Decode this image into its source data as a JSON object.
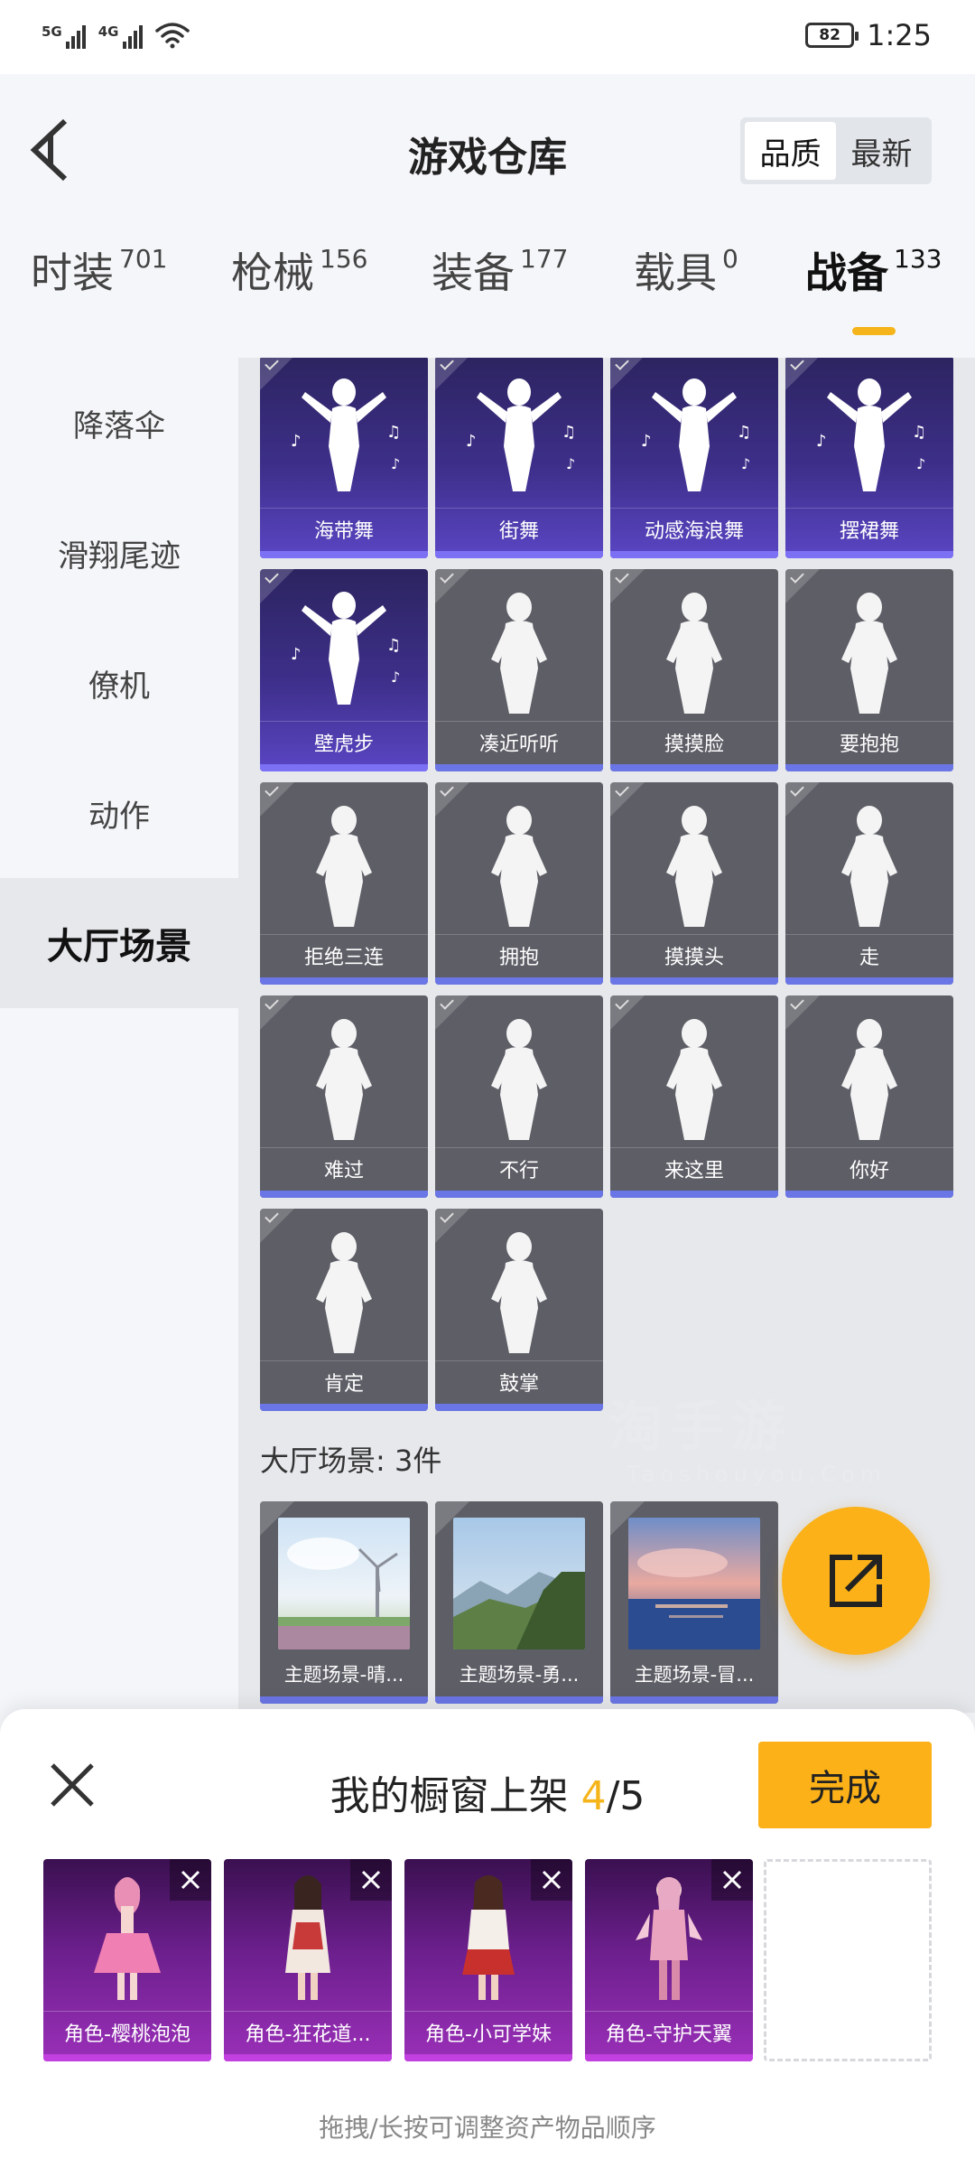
{
  "status_bar": {
    "sim1_label": "5G",
    "sim2_label": "4G",
    "battery": "82",
    "time": "1:25"
  },
  "header": {
    "title": "游戏仓库",
    "sort_options": [
      {
        "label": "品质",
        "active": true
      },
      {
        "label": "最新",
        "active": false
      }
    ]
  },
  "tabs": [
    {
      "label": "时装",
      "count": "701"
    },
    {
      "label": "枪械",
      "count": "156"
    },
    {
      "label": "装备",
      "count": "177"
    },
    {
      "label": "载具",
      "count": "0"
    },
    {
      "label": "战备",
      "count": "133",
      "active": true
    }
  ],
  "sidebar": {
    "items": [
      {
        "label": "降落伞"
      },
      {
        "label": "滑翔尾迹"
      },
      {
        "label": "僚机"
      },
      {
        "label": "动作"
      },
      {
        "label": "大厅场景",
        "active": true
      }
    ]
  },
  "actions": {
    "items": [
      {
        "label": "海带舞",
        "style": "purple",
        "icon": "dance-figure-icon"
      },
      {
        "label": "街舞",
        "style": "purple",
        "icon": "dance-figure-icon"
      },
      {
        "label": "动感海浪舞",
        "style": "purple",
        "icon": "dance-figure-icon"
      },
      {
        "label": "摆裙舞",
        "style": "purple",
        "icon": "dance-figure-icon"
      },
      {
        "label": "壁虎步",
        "style": "purple",
        "icon": "dance-figure-icon"
      },
      {
        "label": "凑近听听",
        "style": "gray",
        "icon": "listen-figure-icon"
      },
      {
        "label": "摸摸脸",
        "style": "gray",
        "icon": "touch-face-figure-icon"
      },
      {
        "label": "要抱抱",
        "style": "gray",
        "icon": "open-arms-figure-icon"
      },
      {
        "label": "拒绝三连",
        "style": "gray",
        "icon": "crossed-arms-figure-icon"
      },
      {
        "label": "拥抱",
        "style": "gray",
        "icon": "hug-figure-icon"
      },
      {
        "label": "摸摸头",
        "style": "gray",
        "icon": "pat-head-figure-icon"
      },
      {
        "label": "走",
        "style": "gray",
        "icon": "pointing-hand-icon"
      },
      {
        "label": "难过",
        "style": "gray",
        "icon": "sad-figure-icon"
      },
      {
        "label": "不行",
        "style": "gray",
        "icon": "head-shake-figure-icon"
      },
      {
        "label": "来这里",
        "style": "gray",
        "icon": "beckon-figure-icon"
      },
      {
        "label": "你好",
        "style": "gray",
        "icon": "wave-figure-icon"
      },
      {
        "label": "肯定",
        "style": "gray",
        "icon": "nod-figure-icon"
      },
      {
        "label": "鼓掌",
        "style": "gray",
        "icon": "clapping-hands-icon"
      }
    ]
  },
  "scenes": {
    "title": "大厅场景: 3件",
    "items": [
      {
        "label": "主题场景-晴...",
        "icon": "scene-windmill-thumbnail"
      },
      {
        "label": "主题场景-勇...",
        "icon": "scene-mountain-thumbnail"
      },
      {
        "label": "主题场景-冒...",
        "icon": "scene-sunset-sea-thumbnail"
      }
    ]
  },
  "showcase": {
    "title_prefix": "我的橱窗上架 ",
    "current": "4",
    "total": "/5",
    "done_label": "完成",
    "slots": [
      {
        "label": "角色-樱桃泡泡",
        "icon": "character-pink-dress-icon"
      },
      {
        "label": "角色-狂花道...",
        "icon": "character-kimono-icon"
      },
      {
        "label": "角色-小可学妹",
        "icon": "character-shrine-maiden-icon"
      },
      {
        "label": "角色-守护天翼",
        "icon": "character-angel-icon"
      }
    ],
    "hint": "拖拽/长按可调整资产物品顺序"
  },
  "watermark": {
    "text": "淘手游",
    "url": "Taoshouyou.Com"
  },
  "colors": {
    "accent": "#fbb117",
    "purple_card": "#3d2f8a",
    "gray_card": "#5d5e66",
    "showcase_card": "#6b1f8c"
  }
}
